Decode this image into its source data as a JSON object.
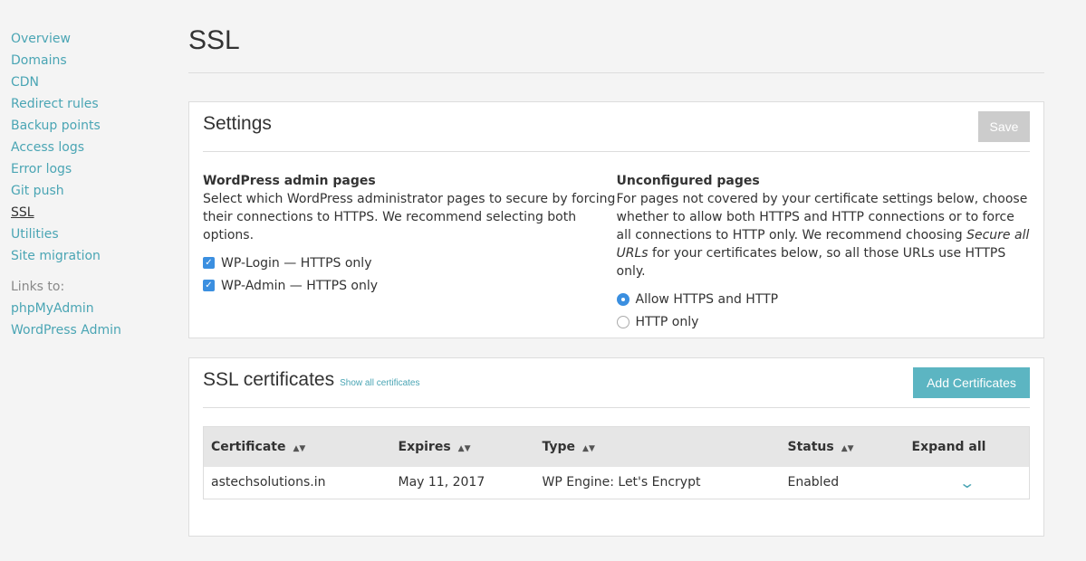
{
  "sidebar": {
    "items": [
      "Overview",
      "Domains",
      "CDN",
      "Redirect rules",
      "Backup points",
      "Access logs",
      "Error logs",
      "Git push",
      "SSL",
      "Utilities",
      "Site migration"
    ],
    "links_label": "Links to:",
    "links": [
      "phpMyAdmin",
      "WordPress Admin"
    ]
  },
  "page": {
    "title": "SSL"
  },
  "settings": {
    "title": "Settings",
    "save_label": "Save",
    "admin": {
      "heading": "WordPress admin pages",
      "desc": "Select which WordPress administrator pages to secure by forcing their connections to HTTPS. We recommend selecting both options.",
      "opt1": "WP-Login — HTTPS only",
      "opt2": "WP-Admin — HTTPS only"
    },
    "unconfigured": {
      "heading": "Unconfigured pages",
      "desc_a": "For pages not covered by your certificate settings below, choose whether to allow both HTTPS and HTTP connections or to force all connections to HTTP only. We recommend choosing ",
      "desc_em": "Secure all URLs",
      "desc_b": " for your certificates below, so all those URLs use HTTPS only.",
      "opt1": "Allow HTTPS and HTTP",
      "opt2": "HTTP only"
    }
  },
  "certs": {
    "title": "SSL certificates",
    "show_all": "Show all certificates",
    "add_label": "Add Certificates",
    "columns": [
      "Certificate",
      "Expires",
      "Type",
      "Status",
      "Expand all"
    ],
    "rows": [
      {
        "certificate": "astechsolutions.in",
        "expires": "May 11, 2017",
        "type": "WP Engine: Let's Encrypt",
        "status": "Enabled"
      }
    ]
  }
}
